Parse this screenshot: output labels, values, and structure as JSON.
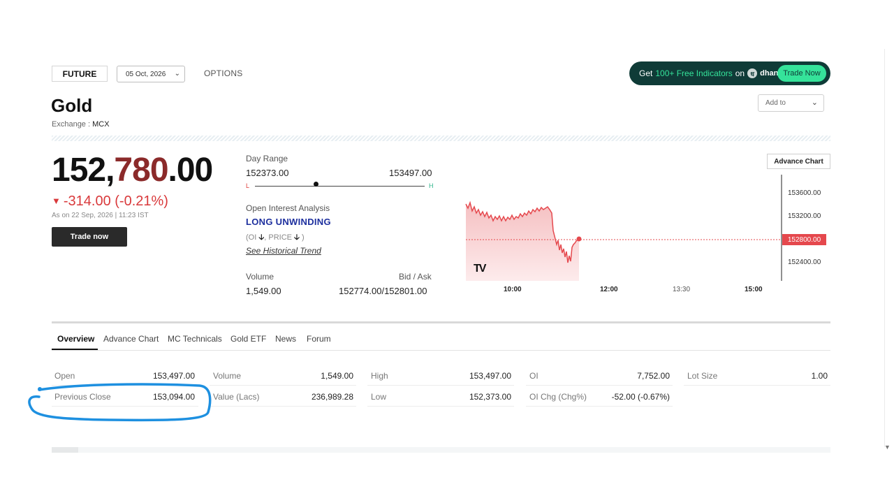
{
  "header": {
    "future_tab": "FUTURE",
    "expiry_select": "05 Oct, 2026",
    "options_tab": "OPTIONS",
    "banner": {
      "prefix": "Get",
      "highlight": "100+ Free Indicators",
      "suffix": "on",
      "brand": "dhan",
      "brand_symbol": "ध",
      "button": "Trade Now"
    }
  },
  "instrument": {
    "name": "Gold",
    "exchange_label": "Exchange :",
    "exchange": "MCX",
    "add_to": "Add to"
  },
  "quote": {
    "price_main": "152,",
    "price_red": "780",
    "price_decimal": ".00",
    "change": "-314.00 (-0.21%)",
    "as_of": "As on 22 Sep, 2026 | 11:23 IST",
    "trade_button": "Trade now"
  },
  "day_range": {
    "label": "Day Range",
    "low": "152373.00",
    "high": "153497.00",
    "low_marker": "L",
    "high_marker": "H",
    "current_fraction": 0.36
  },
  "open_interest": {
    "label": "Open Interest Analysis",
    "value": "LONG UNWINDING",
    "sub_prefix": "(OI",
    "sub_mid": ", PRICE",
    "sub_suffix": ")",
    "link": "See Historical Trend"
  },
  "volume": {
    "label": "Volume",
    "value": "1,549.00"
  },
  "bid_ask": {
    "label": "Bid / Ask",
    "value": "152774.00/152801.00"
  },
  "chart": {
    "advance_button": "Advance Chart",
    "y_ticks": [
      "153600.00",
      "153200.00",
      "152800.00",
      "152400.00"
    ],
    "current_price_label": "152800.00",
    "x_ticks": [
      "10:00",
      "12:00",
      "13:30",
      "15:00"
    ],
    "logo": "TV",
    "line_color": "#e5484d",
    "fill_color": "#f7c9ca"
  },
  "tabs": [
    "Overview",
    "Advance Chart",
    "MC Technicals",
    "Gold ETF",
    "News",
    "Forum"
  ],
  "stats": [
    {
      "label": "Open",
      "value": "153,497.00"
    },
    {
      "label": "Previous Close",
      "value": "153,094.00"
    },
    {
      "label": "Volume",
      "value": "1,549.00"
    },
    {
      "label": "Value (Lacs)",
      "value": "236,989.28"
    },
    {
      "label": "High",
      "value": "153,497.00"
    },
    {
      "label": "Low",
      "value": "152,373.00"
    },
    {
      "label": "OI",
      "value": "7,752.00"
    },
    {
      "label": "OI Chg (Chg%)",
      "value": "-52.00 (-0.67%)"
    },
    {
      "label": "Lot Size",
      "value": "1.00"
    }
  ],
  "annotation_color": "#1e90e0"
}
